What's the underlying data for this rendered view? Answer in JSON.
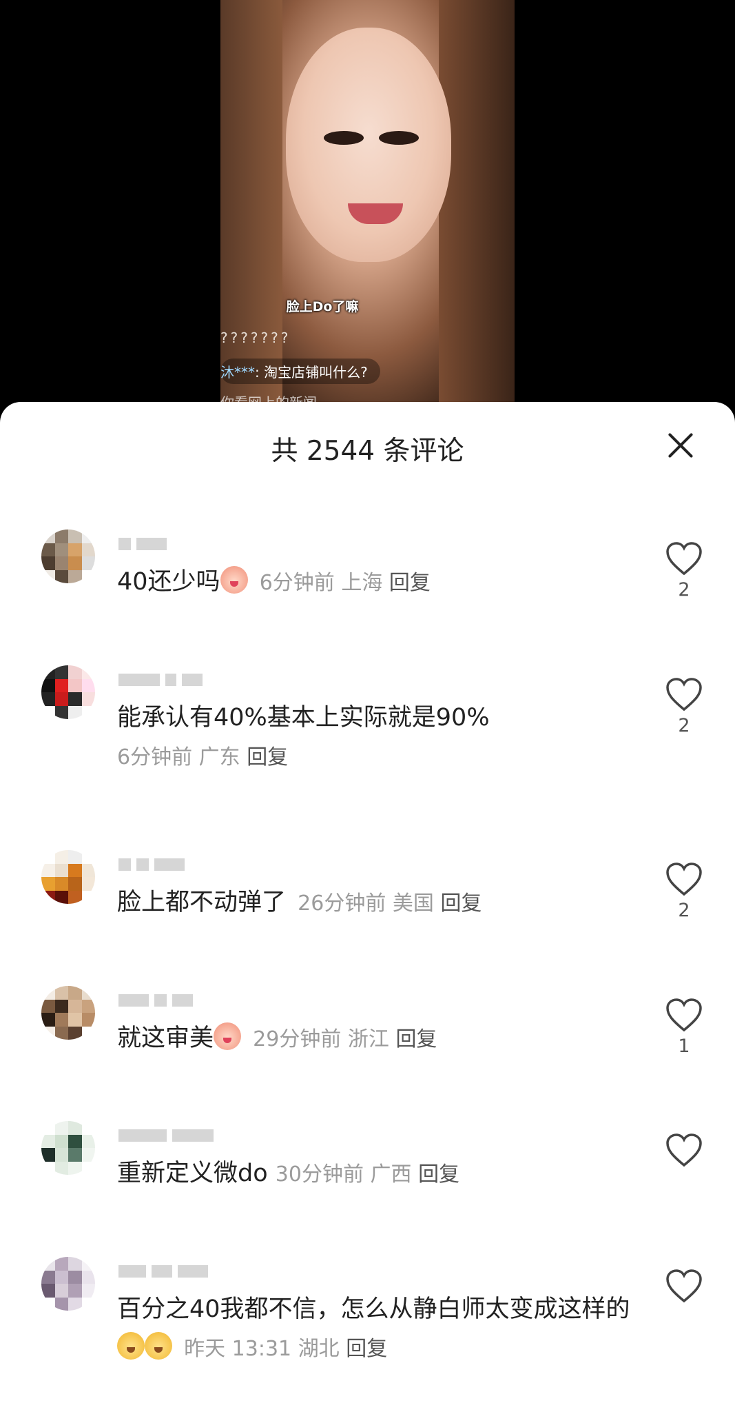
{
  "live": {
    "subtitle": "脸上Do了嘛",
    "question_marks": "???????",
    "chat_user": "沐***",
    "chat_text": ": 淘宝店铺叫什么?",
    "faded_text": "你看网上的新闻"
  },
  "sheet": {
    "title": "共 2544 条评论"
  },
  "comments": [
    {
      "text": "40还少吗",
      "emoji": "crying-emoji",
      "time": "6分钟前",
      "location": "上海",
      "reply": "回复",
      "likes": "2"
    },
    {
      "text": "能承认有40%基本上实际就是90%",
      "time": "6分钟前",
      "location": "广东",
      "reply": "回复",
      "likes": "2"
    },
    {
      "text": "脸上都不动弹了",
      "time": "26分钟前",
      "location": "美国",
      "reply": "回复",
      "likes": "2"
    },
    {
      "text": "就这审美",
      "emoji": "crying-emoji",
      "time": "29分钟前",
      "location": "浙江",
      "reply": "回复",
      "likes": "1"
    },
    {
      "text": "重新定义微do",
      "time": "30分钟前",
      "location": "广西",
      "reply": "回复",
      "likes": ""
    },
    {
      "text": "百分之40我都不信，怎么从静白师太变成这样的",
      "emoji": "dog-emoji",
      "time": "昨天 13:31",
      "location": "湖北",
      "reply": "回复",
      "likes": ""
    }
  ],
  "colors": {
    "accent": "#222222",
    "meta": "#9b9b9b"
  }
}
